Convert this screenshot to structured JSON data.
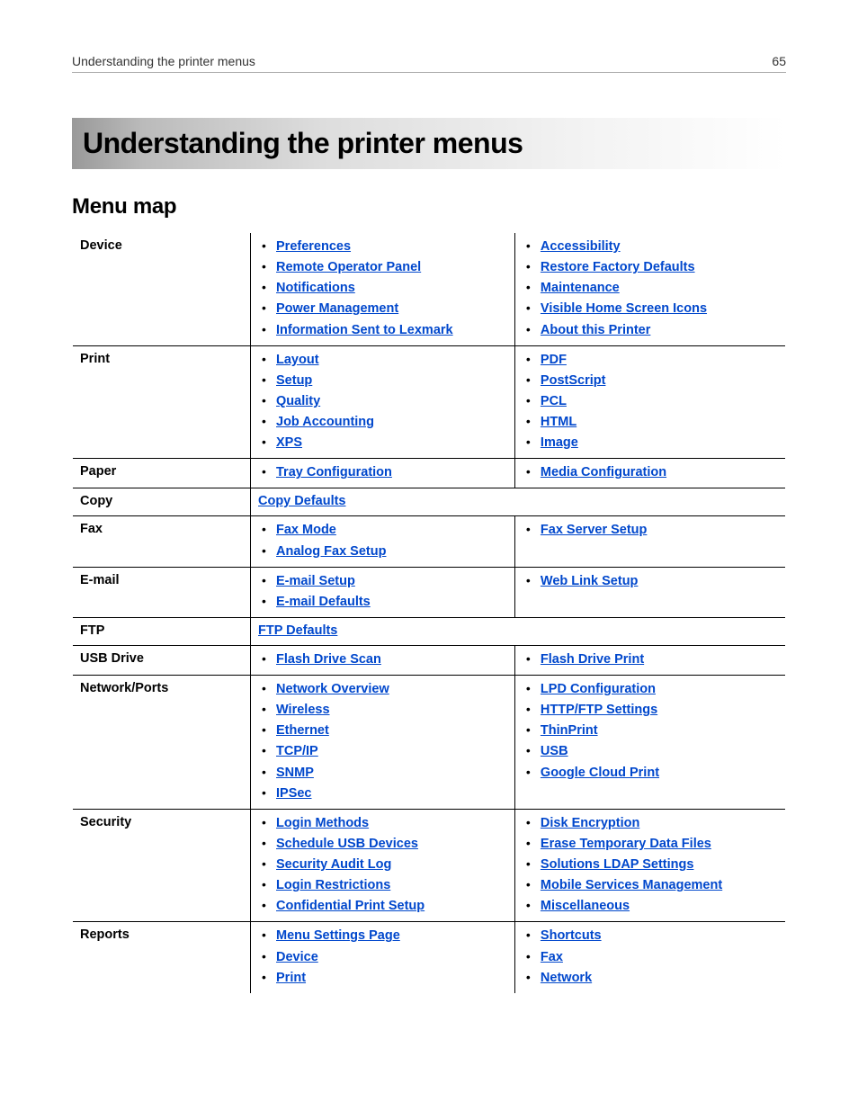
{
  "header": {
    "running_title": "Understanding the printer menus",
    "page_number": "65"
  },
  "banner_title": "Understanding the printer menus",
  "section_title": "Menu map",
  "rows": [
    {
      "category": "Device",
      "left": [
        "Preferences",
        "Remote Operator Panel",
        "Notifications",
        "Power Management",
        "Information Sent to Lexmark"
      ],
      "right": [
        "Accessibility",
        "Restore Factory Defaults",
        "Maintenance",
        "Visible Home Screen Icons",
        "About this Printer"
      ]
    },
    {
      "category": "Print",
      "left": [
        "Layout",
        "Setup",
        "Quality",
        "Job Accounting",
        "XPS"
      ],
      "right": [
        "PDF",
        "PostScript",
        "PCL",
        "HTML",
        "Image"
      ]
    },
    {
      "category": "Paper",
      "left": [
        "Tray Configuration"
      ],
      "right": [
        "Media Configuration"
      ]
    },
    {
      "category": "Copy",
      "single": "Copy Defaults"
    },
    {
      "category": "Fax",
      "left": [
        "Fax Mode",
        "Analog Fax Setup"
      ],
      "right": [
        "Fax Server Setup"
      ]
    },
    {
      "category": "E-mail",
      "left": [
        "E-mail Setup",
        "E-mail Defaults"
      ],
      "right": [
        "Web Link Setup"
      ]
    },
    {
      "category": "FTP",
      "single": "FTP Defaults"
    },
    {
      "category": "USB Drive",
      "left": [
        "Flash Drive Scan"
      ],
      "right": [
        "Flash Drive Print"
      ]
    },
    {
      "category": "Network/Ports",
      "left": [
        "Network Overview",
        "Wireless",
        "Ethernet",
        "TCP/IP",
        "SNMP",
        "IPSec"
      ],
      "right": [
        "LPD Configuration",
        "HTTP/FTP Settings",
        "ThinPrint",
        "USB",
        "Google Cloud Print"
      ]
    },
    {
      "category": "Security",
      "left": [
        "Login Methods",
        "Schedule USB Devices",
        "Security Audit Log",
        "Login Restrictions",
        "Confidential Print Setup"
      ],
      "right": [
        "Disk Encryption",
        "Erase Temporary Data Files",
        "Solutions LDAP Settings",
        "Mobile Services Management",
        "Miscellaneous"
      ]
    },
    {
      "category": "Reports",
      "left": [
        "Menu Settings Page",
        "Device",
        "Print"
      ],
      "right": [
        "Shortcuts",
        "Fax",
        "Network"
      ]
    }
  ]
}
